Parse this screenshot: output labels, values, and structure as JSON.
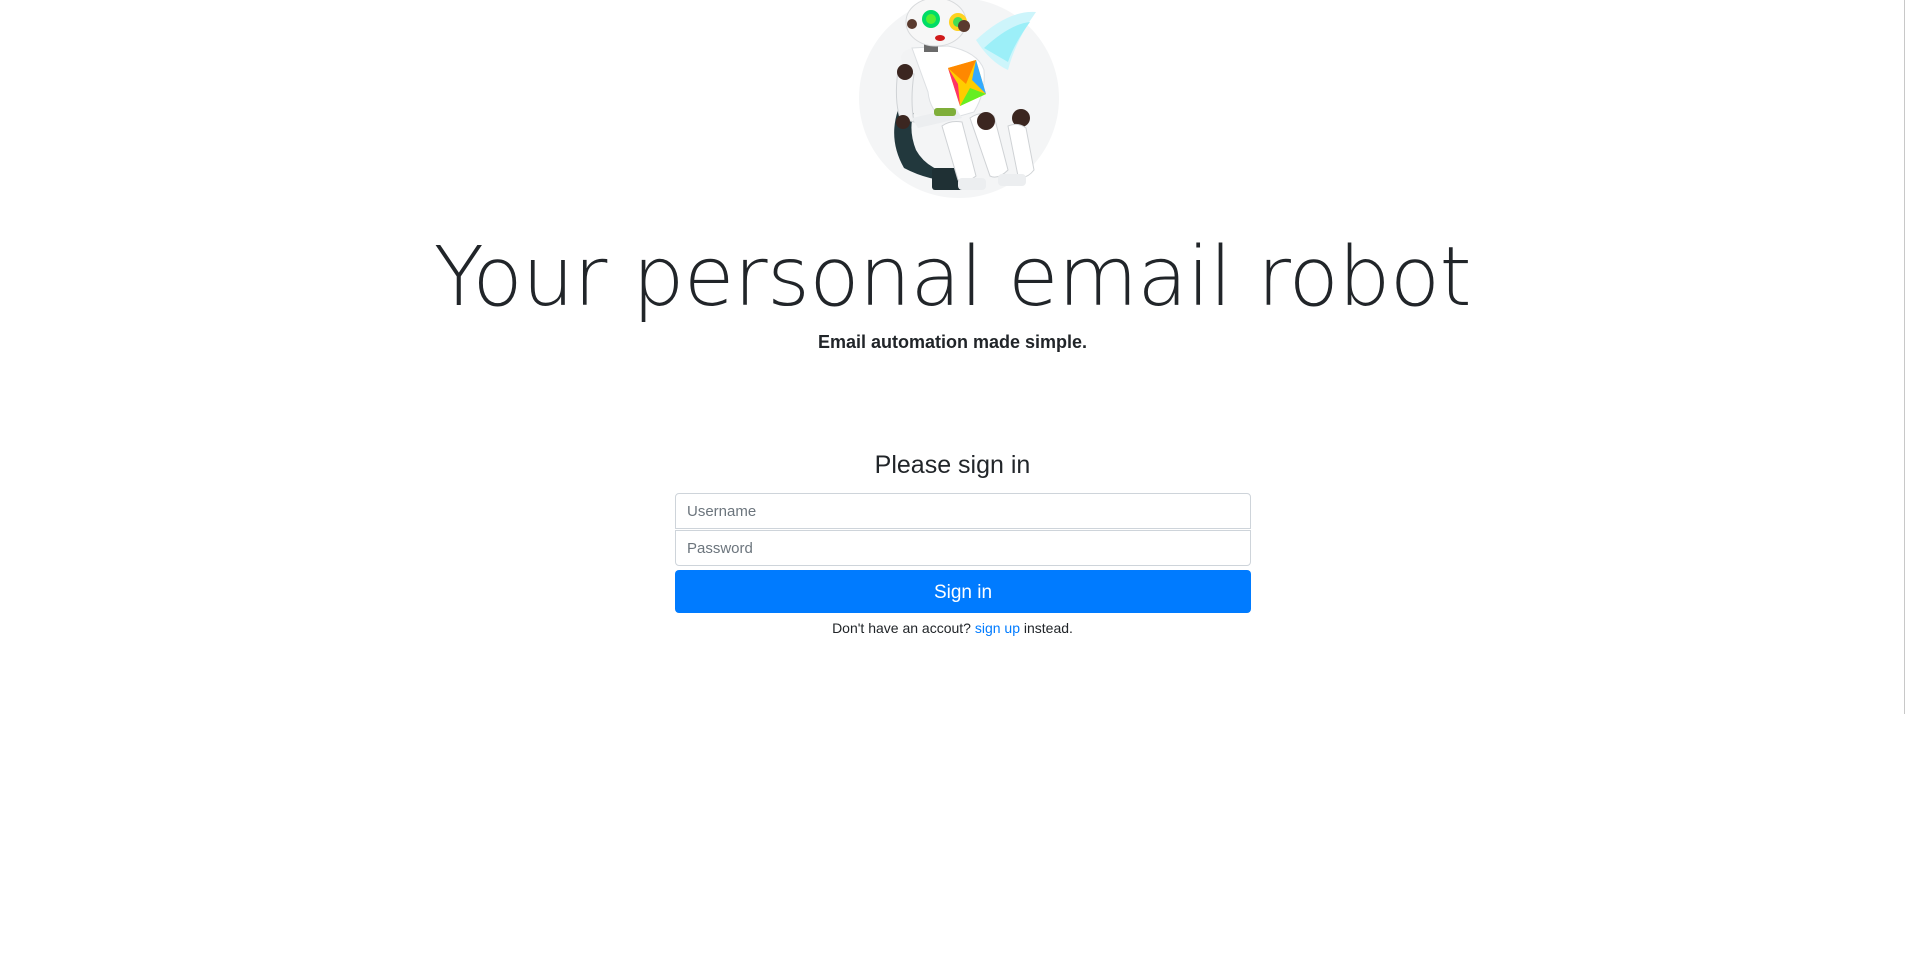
{
  "hero": {
    "title": "Your personal email robot",
    "subtitle": "Email automation made simple."
  },
  "signin": {
    "heading": "Please sign in",
    "username_placeholder": "Username",
    "password_placeholder": "Password",
    "username_value": "",
    "password_value": "",
    "button_label": "Sign in"
  },
  "signup_note": {
    "prefix": "Don't have an accout?",
    "link_label": "sign up",
    "suffix": "instead."
  },
  "colors": {
    "primary": "#007bff",
    "text": "#212529",
    "input_border": "#ced4da"
  }
}
